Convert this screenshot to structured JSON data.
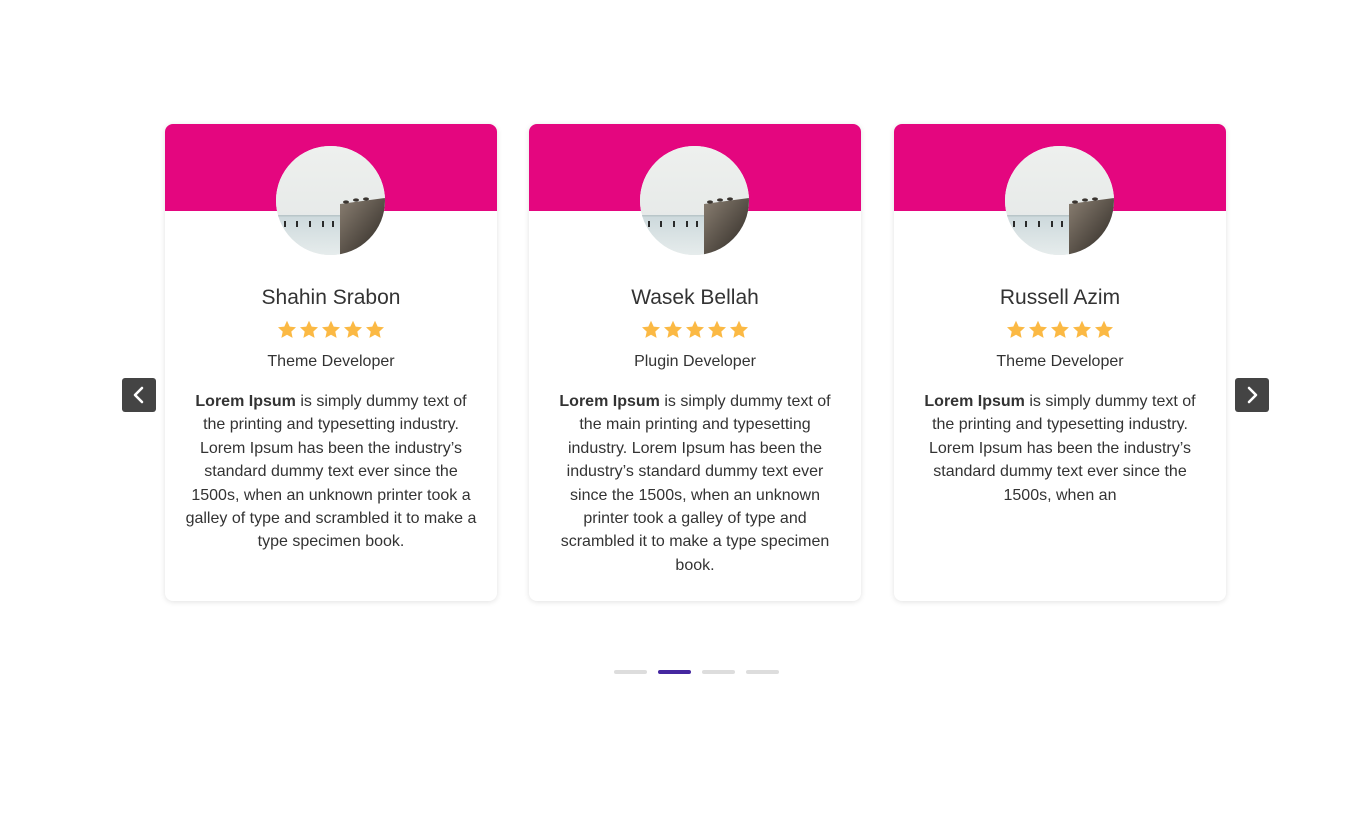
{
  "colors": {
    "header": "#e4067f",
    "star": "#fbb944",
    "nav_bg": "#444444",
    "dot_active": "#4527a0",
    "dot_inactive": "#dddddd"
  },
  "nav": {
    "prev_icon": "chevron-left-icon",
    "next_icon": "chevron-right-icon"
  },
  "cards": [
    {
      "name": "Shahin Srabon",
      "rating": 5,
      "role": "Theme Developer",
      "desc_bold": "Lorem Ipsum",
      "desc_rest": " is simply dummy text of the printing and typesetting industry. Lorem Ipsum has been the industry’s standard dummy text ever since the 1500s, when an unknown printer took a galley of type and scrambled it to make a type specimen book."
    },
    {
      "name": "Wasek Bellah",
      "rating": 5,
      "role": "Plugin Developer",
      "desc_bold": "Lorem Ipsum",
      "desc_rest": " is simply dummy text of the main printing and typesetting industry. Lorem Ipsum has been the industry’s standard dummy text ever since the 1500s, when an unknown printer took a galley of type and scrambled it to make a type specimen book."
    },
    {
      "name": "Russell Azim",
      "rating": 5,
      "role": "Theme Developer",
      "desc_bold": "Lorem Ipsum",
      "desc_rest": " is simply dummy text of the printing and typesetting industry. Lorem Ipsum has been the industry’s standard dummy text ever since the 1500s, when an"
    }
  ],
  "pagination": {
    "count": 4,
    "active": 1
  }
}
